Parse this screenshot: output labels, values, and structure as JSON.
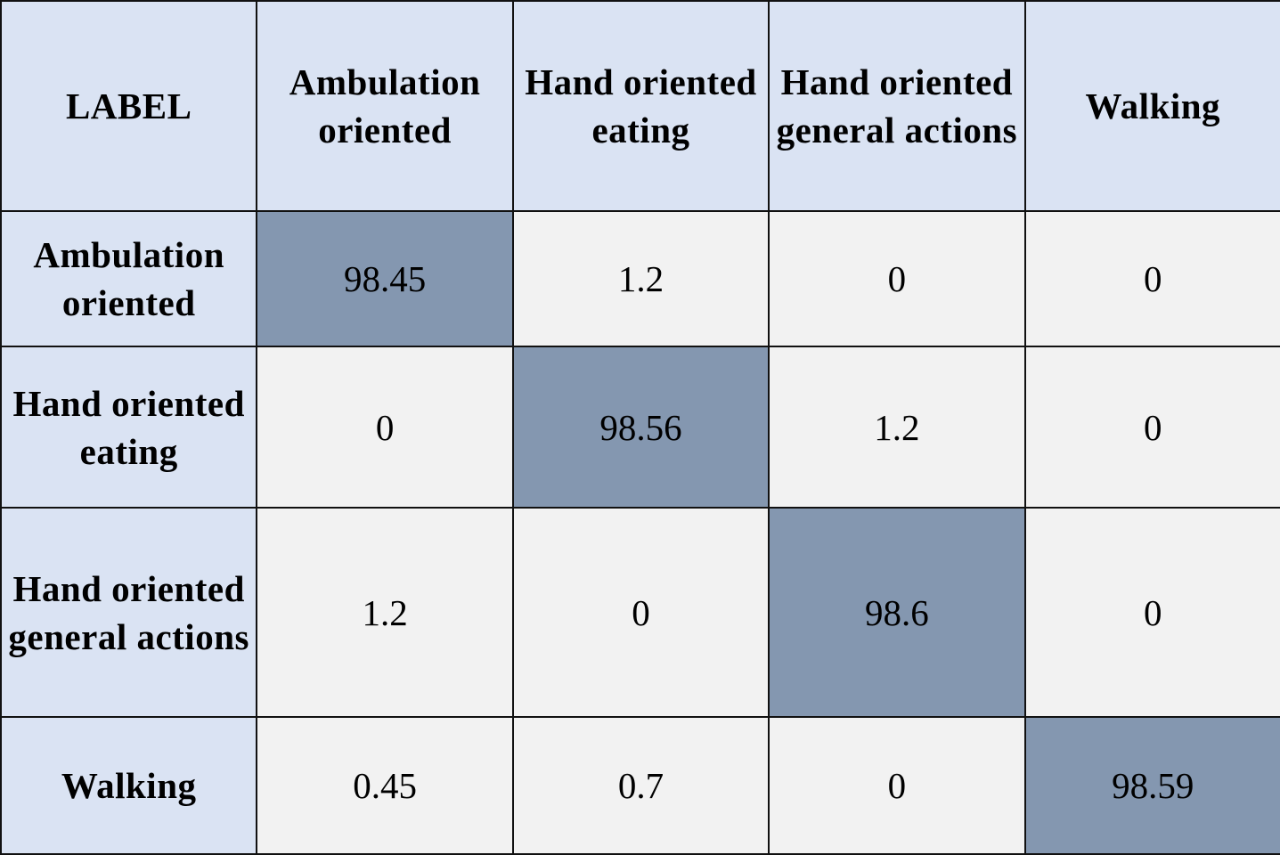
{
  "chart_data": {
    "type": "table",
    "title": "",
    "corner_label": "LABEL",
    "columns": [
      "Ambulation oriented",
      "Hand oriented eating",
      "Hand oriented general actions",
      "Walking"
    ],
    "rows": [
      {
        "label": "Ambulation oriented",
        "values": [
          "98.45",
          "1.2",
          "0",
          "0"
        ]
      },
      {
        "label": "Hand oriented eating",
        "values": [
          "0",
          "98.56",
          "1.2",
          "0"
        ]
      },
      {
        "label": "Hand oriented general actions",
        "values": [
          "1.2",
          "0",
          "98.6",
          "0"
        ]
      },
      {
        "label": "Walking",
        "values": [
          "0.45",
          "0.7",
          "0",
          "98.59"
        ]
      }
    ],
    "colors": {
      "header_bg": "#dae3f3",
      "diagonal_bg": "#8497b0",
      "cell_bg": "#f2f2f2",
      "border": "#111111"
    }
  }
}
